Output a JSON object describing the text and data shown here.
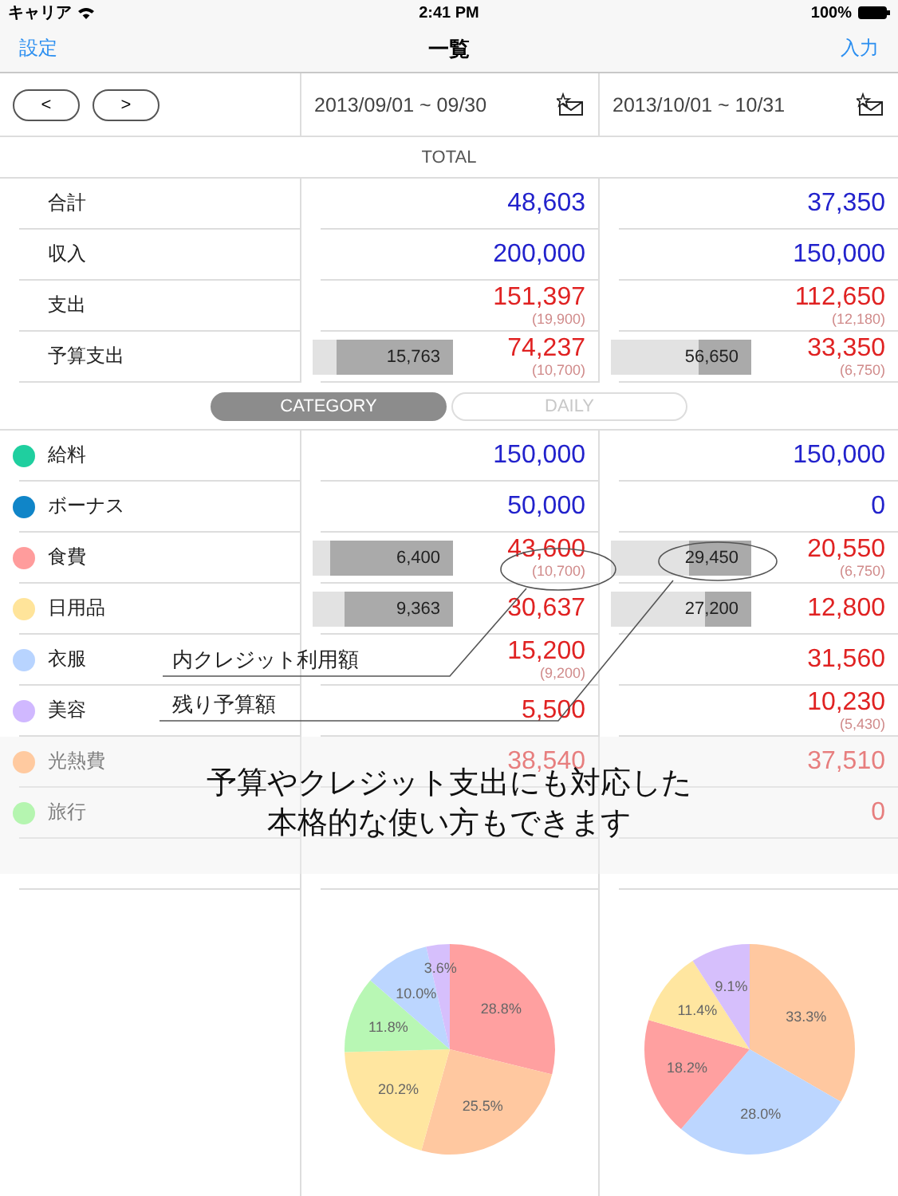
{
  "status_bar": {
    "carrier": "キャリア",
    "time": "2:41 PM",
    "battery": "100%"
  },
  "nav": {
    "left": "設定",
    "title": "一覧",
    "right": "入力"
  },
  "pager": {
    "prev": "<",
    "next": ">"
  },
  "periods": [
    "2013/09/01 ~ 09/30",
    "2013/10/01 ~ 10/31"
  ],
  "total": {
    "heading": "TOTAL",
    "rows": [
      {
        "label": "合計",
        "kind": "income",
        "cells": [
          {
            "value": "48,603"
          },
          {
            "value": "37,350"
          }
        ]
      },
      {
        "label": "収入",
        "kind": "income",
        "cells": [
          {
            "value": "200,000"
          },
          {
            "value": "150,000"
          }
        ]
      },
      {
        "label": "支出",
        "kind": "expense",
        "cells": [
          {
            "value": "151,397",
            "note": "(19,900)"
          },
          {
            "value": "112,650",
            "note": "(12,180)"
          }
        ]
      },
      {
        "label": "予算支出",
        "kind": "expense",
        "cells": [
          {
            "value": "74,237",
            "note": "(10,700)",
            "bar": {
              "label": "15,763",
              "level": 0.83
            }
          },
          {
            "value": "33,350",
            "note": "(6,750)",
            "bar": {
              "label": "56,650",
              "level": 0.38
            }
          }
        ]
      }
    ]
  },
  "tabs": [
    {
      "label": "CATEGORY",
      "selected": true
    },
    {
      "label": "DAILY",
      "selected": false
    }
  ],
  "categories": [
    {
      "label": "給料",
      "color": "#1fcf9f",
      "kind": "income",
      "cells": [
        {
          "value": "150,000"
        },
        {
          "value": "150,000"
        }
      ]
    },
    {
      "label": "ボーナス",
      "color": "#1085c8",
      "kind": "income",
      "cells": [
        {
          "value": "50,000"
        },
        {
          "value": "0"
        }
      ]
    },
    {
      "label": "食費",
      "color": "#ff9c9c",
      "kind": "expense",
      "cells": [
        {
          "value": "43,600",
          "note": "(10,700)",
          "bar": {
            "label": "6,400",
            "level": 0.87
          }
        },
        {
          "value": "20,550",
          "note": "(6,750)",
          "bar": {
            "label": "29,450",
            "level": 0.44
          }
        }
      ]
    },
    {
      "label": "日用品",
      "color": "#ffe49a",
      "kind": "expense",
      "cells": [
        {
          "value": "30,637",
          "bar": {
            "label": "9,363",
            "level": 0.77
          }
        },
        {
          "value": "12,800",
          "bar": {
            "label": "27,200",
            "level": 0.33
          }
        }
      ]
    },
    {
      "label": "衣服",
      "color": "#b8d4ff",
      "kind": "expense",
      "cells": [
        {
          "value": "15,200",
          "note": "(9,200)"
        },
        {
          "value": "31,560"
        }
      ]
    },
    {
      "label": "美容",
      "color": "#d0b8ff",
      "kind": "expense",
      "cells": [
        {
          "value": "5,500"
        },
        {
          "value": "10,230",
          "note": "(5,430)"
        }
      ]
    },
    {
      "label": "光熱費",
      "color": "#ffcaa0",
      "kind": "expense",
      "cells": [
        {
          "value": "38,540"
        },
        {
          "value": "37,510"
        }
      ]
    },
    {
      "label": "旅行",
      "color": "#b5f5b0",
      "kind": "expense",
      "cells": [
        {},
        {
          "value": "0"
        }
      ]
    }
  ],
  "callouts": [
    {
      "text": "内クレジット利用額"
    },
    {
      "text": "残り予算額"
    }
  ],
  "banner": {
    "lines": [
      "予算やクレジット支出にも対応した",
      "本格的な使い方もできます"
    ]
  },
  "charts": [
    {
      "chart_data": {
        "type": "pie",
        "values": [
          28.8,
          25.5,
          20.2,
          11.8,
          10.0,
          3.6
        ],
        "colors": [
          "#ffa0a0",
          "#ffc8a0",
          "#ffe6a0",
          "#b8f7b4",
          "#bcd6ff",
          "#d6bffc"
        ],
        "value_labels": [
          "28.8%",
          "25.5%",
          "20.2%",
          "11.8%",
          "10.0%",
          "3.6%"
        ]
      }
    },
    {
      "chart_data": {
        "type": "pie",
        "values": [
          33.3,
          28.0,
          18.2,
          11.4,
          9.1
        ],
        "colors": [
          "#ffc8a0",
          "#bcd6ff",
          "#ffa0a0",
          "#ffe6a0",
          "#d6bffc"
        ],
        "value_labels": [
          "33.3%",
          "28.0%",
          "18.2%",
          "11.4%",
          "9.1%"
        ]
      }
    }
  ]
}
